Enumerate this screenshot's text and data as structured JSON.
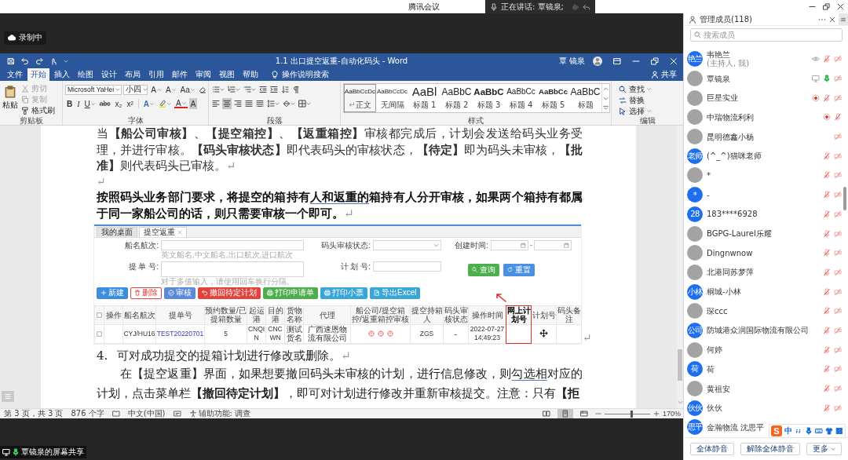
{
  "meeting": {
    "title": "腾讯会议",
    "speaking": "正在讲话: 覃镜泉;",
    "recording": "录制中",
    "share_label": "覃镜泉的屏幕共享"
  },
  "word": {
    "title": "1.1 出口提空返重-自动化码头 - Word",
    "user": "覃 镜泉",
    "tabs": [
      {
        "label": "文件",
        "selected": false
      },
      {
        "label": "开始",
        "selected": true
      },
      {
        "label": "插入",
        "selected": false
      },
      {
        "label": "绘图",
        "selected": false
      },
      {
        "label": "设计",
        "selected": false
      },
      {
        "label": "布局",
        "selected": false
      },
      {
        "label": "引用",
        "selected": false
      },
      {
        "label": "邮件",
        "selected": false
      },
      {
        "label": "审阅",
        "selected": false
      },
      {
        "label": "视图",
        "selected": false
      },
      {
        "label": "帮助",
        "selected": false
      }
    ],
    "tell_me": "操作说明搜索",
    "share": "共享",
    "ribbon": {
      "clipboard": {
        "label": "剪贴板",
        "paste": "粘贴",
        "tools": [
          {
            "kind": "cut",
            "label": "剪切",
            "disabled": true
          },
          {
            "kind": "copy",
            "label": "复制",
            "disabled": true
          },
          {
            "kind": "painter",
            "label": "格式刷",
            "disabled": false
          }
        ]
      },
      "font": {
        "label": "字体",
        "name": "Microsoft YaHei",
        "size": "小四",
        "size_tools": [
          {
            "kind": "grow",
            "label": "A"
          },
          {
            "kind": "shrink",
            "label": "A"
          },
          {
            "kind": "case",
            "label": "Aa"
          }
        ],
        "format_tools": [
          {
            "kind": "bold",
            "label": "B"
          },
          {
            "kind": "italic",
            "label": "I"
          },
          {
            "kind": "underline",
            "label": "U"
          },
          {
            "kind": "strike",
            "label": "abc"
          },
          {
            "kind": "sub",
            "label": "x₂"
          },
          {
            "kind": "sup",
            "label": "x²"
          }
        ],
        "color_tools": [
          {
            "kind": "effects",
            "label": "A"
          },
          {
            "kind": "highlight"
          },
          {
            "kind": "color",
            "label": "A"
          },
          {
            "kind": "shade",
            "label": "A"
          }
        ]
      },
      "paragraph": {
        "label": "段落",
        "align": [
          {
            "kind": "left",
            "selected": false
          },
          {
            "kind": "center",
            "selected": true
          },
          {
            "kind": "right",
            "selected": false
          },
          {
            "kind": "justify",
            "selected": false
          },
          {
            "kind": "distribute",
            "selected": false
          }
        ]
      },
      "styles": {
        "label": "样式",
        "items": [
          {
            "kind": "normal",
            "preview": "AaBbCcDc",
            "name": "正文",
            "mark": "↵",
            "selected": true
          },
          {
            "kind": "normal",
            "preview": "AaBbCcDc",
            "name": "无间隔",
            "selected": false
          },
          {
            "kind": "large",
            "preview": "AaBl",
            "name": "标题 1",
            "selected": false
          },
          {
            "kind": "medium",
            "preview": "AaBbC",
            "name": "标题 2",
            "selected": false
          },
          {
            "kind": "mediumbold",
            "preview": "AaBbC",
            "name": "标题 3",
            "selected": false
          },
          {
            "kind": "small",
            "preview": "AaBbCc",
            "name": "标题 4",
            "selected": false
          },
          {
            "kind": "smallbold",
            "preview": "AaBbCc",
            "name": "标题 5",
            "selected": false
          },
          {
            "kind": "medium",
            "preview": "AaBbC",
            "name": "标题",
            "selected": false
          }
        ]
      },
      "editing": {
        "label": "编辑",
        "items": [
          {
            "kind": "find",
            "label": "查找"
          },
          {
            "kind": "replace",
            "label": "替换"
          },
          {
            "kind": "select",
            "label": "选择"
          }
        ]
      }
    },
    "document": [
      {
        "kind": "paragraph",
        "segments": [
          {
            "text": "当**【船公司审核】**、**【提空箱控】**、**【返重箱控】**审核都完成后，计划会发送给码头业务受理，并进行审核。**【码头审核状态】**即代表码头的审核状态，**【待定】**即为码头未审核，**【批准】**则代表码头已审核。",
            "flagged": false
          }
        ],
        "mark": "↵"
      },
      {
        "kind": "empty",
        "mark": "↵"
      },
      {
        "kind": "emphasis",
        "segments": [
          {
            "text": "按照码头业务部门要求，将提空的箱持有",
            "flagged": false
          },
          {
            "text": "人和返重的",
            "flagged": true
          },
          {
            "text": "箱持有人分开审核，如果两个箱持有都属于同一家船公司的话，则只需要审核一个即可。",
            "flagged": false
          }
        ],
        "mark": "↵"
      },
      {
        "kind": "screenshot",
        "tabs": [
          {
            "label": "我的桌面",
            "selected": false,
            "closable": false
          },
          {
            "label": "提空返重",
            "selected": true,
            "closable": true
          }
        ],
        "filters": [
          {
            "kind": "text",
            "label": "船名航次:",
            "hint": "英文船名,中文船名,出口航次,进口航次"
          },
          {
            "kind": "select",
            "label": "码头审核状态:"
          },
          {
            "kind": "date_range",
            "label": "创建时间:",
            "separator": "-"
          },
          {
            "kind": "textarea",
            "label": "提 单 号:",
            "hint": "对于多值输入，请使用回车换行分隔。"
          },
          {
            "kind": "text",
            "label": "计 划 号:"
          }
        ],
        "search_buttons": [
          {
            "kind": "search",
            "label": "查询",
            "color": "#4cae4c"
          },
          {
            "kind": "reset",
            "label": "重置",
            "color": "#4a8fe0"
          }
        ],
        "toolbar": [
          {
            "kind": "add",
            "label": "新建",
            "color": "#3c8de0",
            "outline": false
          },
          {
            "kind": "delete",
            "label": "删除",
            "color": "#e0443c",
            "outline": true
          },
          {
            "kind": "approve",
            "label": "审核",
            "color": "#5a8ad8",
            "outline": false
          },
          {
            "kind": "withdraw",
            "label": "撤回待定计划",
            "color": "#e0443c",
            "outline": false
          },
          {
            "kind": "print",
            "label": "打印申请单",
            "color": "#4cae4c",
            "outline": false
          },
          {
            "kind": "print",
            "label": "打印小票",
            "color": "#3aa6d8",
            "outline": false
          },
          {
            "kind": "export",
            "label": "导出Excel",
            "color": "#3aa6d8",
            "outline": false
          }
        ],
        "select_all": {
          "checked": false
        },
        "columns": [
          {
            "label": "操作",
            "highlighted": false
          },
          {
            "label": "船名航次",
            "highlighted": false
          },
          {
            "label": "提单号",
            "highlighted": false
          },
          {
            "label": "预约数量/已提箱数量",
            "highlighted": false
          },
          {
            "label": "起运港",
            "highlighted": false
          },
          {
            "label": "目的港",
            "highlighted": false
          },
          {
            "label": "货物名称",
            "highlighted": false
          },
          {
            "label": "代理",
            "highlighted": false
          },
          {
            "label": "船公司/提空箱控/返重箱控审核",
            "highlighted": false
          },
          {
            "label": "提空持箱人",
            "highlighted": false
          },
          {
            "label": "码头审核状态",
            "highlighted": false
          },
          {
            "label": "操作时间",
            "highlighted": false
          },
          {
            "label": "网上计划号",
            "highlighted": true
          },
          {
            "label": "计划号",
            "highlighted": false
          },
          {
            "label": "码头备注",
            "highlighted": false
          }
        ],
        "rows": [
          {
            "checked": false,
            "cells": [
              null,
              "CYJ/HU16",
              {
                "kind": "link",
                "text": "TEST20220701"
              },
              "5",
              "CNQIN",
              "CNCWN",
              "测试货名",
              "广西速恩物流有限公司",
              {
                "kind": "audit",
                "states": [
                  {
                    "approved": false
                  },
                  {
                    "approved": false
                  },
                  {
                    "approved": false
                  }
                ]
              },
              "ZGS",
              "-",
              "2022-07-27 14:49:23",
              null,
              null,
              null
            ]
          }
        ],
        "mark": "↵"
      },
      {
        "kind": "list_item",
        "number": "4.",
        "segments": [
          {
            "text": "可对成功提交的提箱计划进行修改或删除。",
            "flagged": false
          }
        ],
        "mark": "↵"
      },
      {
        "kind": "indented",
        "segments": [
          {
            "text": "在【提空返重】界面，如果想要撤回码头未审核的计划，进行信息修改，则",
            "flagged": false
          },
          {
            "text": "勾选相",
            "flagged": true
          },
          {
            "text": "对应的计划，点击菜单栏**【撤回待定计划】**，即可对计划进行修改并重新审核提交。注意：只有**【拒**",
            "flagged": false
          }
        ]
      }
    ],
    "status": {
      "pages": "第 3 页，共 3 页",
      "words": "876 个字",
      "language": "中文(中国)",
      "accessibility": "辅助功能: 调查",
      "views": [
        {
          "kind": "read",
          "selected": false
        },
        {
          "kind": "print",
          "selected": true
        },
        {
          "kind": "web",
          "selected": false
        }
      ],
      "zoom_slider": {
        "level": 0.59
      },
      "zoom": "170%"
    }
  },
  "members": {
    "title": "管理成员(118)",
    "search_placeholder": "搜索成员",
    "list": [
      {
        "name": "韦艳兰",
        "note": "(主持人, 我)",
        "avatar": {
          "kind": "text",
          "text": "艳兰"
        },
        "badge": {
          "kind": "viewing"
        },
        "mic_on": false,
        "camera_on": false
      },
      {
        "name": "覃镜泉",
        "avatar": {
          "kind": "photo"
        },
        "badge": {
          "kind": "sharing"
        },
        "mic_on": true,
        "camera_on": false
      },
      {
        "name": "巨星实业",
        "avatar": {
          "kind": "photo"
        },
        "badge": {
          "kind": "recording"
        },
        "mic_on": false,
        "camera_on": false
      },
      {
        "name": "中瑞物流利利",
        "avatar": {
          "kind": "photo"
        },
        "badge": {
          "kind": "recording"
        },
        "mic_on": false
      },
      {
        "name": "昆明德鑫小杨",
        "avatar": {
          "kind": "photo"
        },
        "camera_on": false
      },
      {
        "name": "(^_^)猫咪老师",
        "avatar": {
          "kind": "text",
          "text": "老师"
        },
        "mic_on": false,
        "camera_on": false
      },
      {
        "name": "*",
        "avatar": {
          "kind": "photo"
        },
        "mic_on": false,
        "camera_on": false
      },
      {
        "name": "-",
        "avatar": {
          "kind": "text",
          "text": "*"
        },
        "mic_on": false,
        "camera_on": false
      },
      {
        "name": "183****6928",
        "avatar": {
          "kind": "text",
          "text": "28"
        },
        "mic_on": false,
        "camera_on": false
      },
      {
        "name": "BGPG-Laurel乐耀",
        "avatar": {
          "kind": "photo"
        },
        "mic_on": false,
        "camera_on": false
      },
      {
        "name": "Dingnwnow",
        "avatar": {
          "kind": "photo"
        },
        "mic_on": false,
        "camera_on": false
      },
      {
        "name": "北港同苏梦萍",
        "avatar": {
          "kind": "photo"
        },
        "mic_on": false,
        "camera_on": false
      },
      {
        "name": "桐城-小林",
        "avatar": {
          "kind": "text",
          "text": "小林"
        },
        "mic_on": false,
        "camera_on": false
      },
      {
        "name": "琛ccc",
        "avatar": {
          "kind": "photo"
        },
        "mic_on": false,
        "camera_on": false
      },
      {
        "name": "防城港众润国际物流有限公司",
        "avatar": {
          "kind": "text",
          "text": "公司"
        },
        "mic_on": false,
        "camera_on": false
      },
      {
        "name": "何婷",
        "avatar": {
          "kind": "photo"
        },
        "mic_on": false,
        "camera_on": false
      },
      {
        "name": "荷",
        "avatar": {
          "kind": "text",
          "text": "荷"
        },
        "mic_on": false,
        "camera_on": false
      },
      {
        "name": "黄祖安",
        "avatar": {
          "kind": "photo"
        },
        "mic_on": false,
        "camera_on": false
      },
      {
        "name": "伙伙",
        "avatar": {
          "kind": "text",
          "text": "伙伙"
        },
        "mic_on": false,
        "camera_on": false
      },
      {
        "name": "金瀚物流 沈思平",
        "avatar": {
          "kind": "text",
          "text": "思平"
        }
      }
    ],
    "buttons": [
      {
        "label": "全体静音",
        "menu": false
      },
      {
        "label": "解除全体静音",
        "menu": false
      },
      {
        "label": "更多",
        "menu": true
      }
    ]
  },
  "ime": {
    "logo": "S",
    "mode": "中"
  }
}
